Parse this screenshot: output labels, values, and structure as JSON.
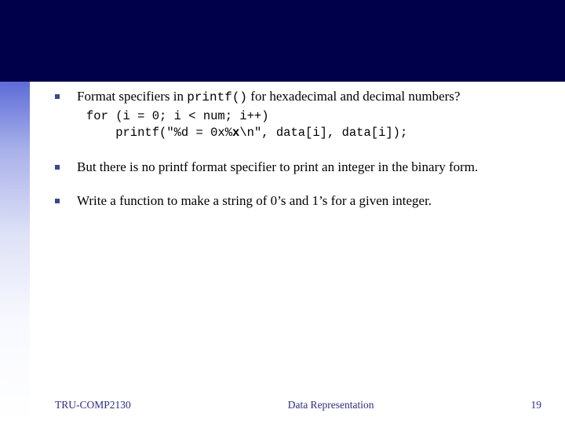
{
  "bullets": [
    {
      "pre": "Format specifiers in ",
      "mono": "printf()",
      "post": " for hexadecimal and decimal numbers?"
    },
    {
      "text": "But there is no printf format specifier to print an integer in the binary form."
    },
    {
      "text": "Write a function to make a string of 0’s and 1’s for a given integer."
    }
  ],
  "code": {
    "line1": "for (i = 0; i < num; i++)",
    "line2_a": "    printf(\"%d = 0x%",
    "line2_b": "x",
    "line2_c": "\\n\", data[i], data[i]);"
  },
  "footer": {
    "left": "TRU-COMP2130",
    "center": "Data Representation",
    "right": "19"
  }
}
